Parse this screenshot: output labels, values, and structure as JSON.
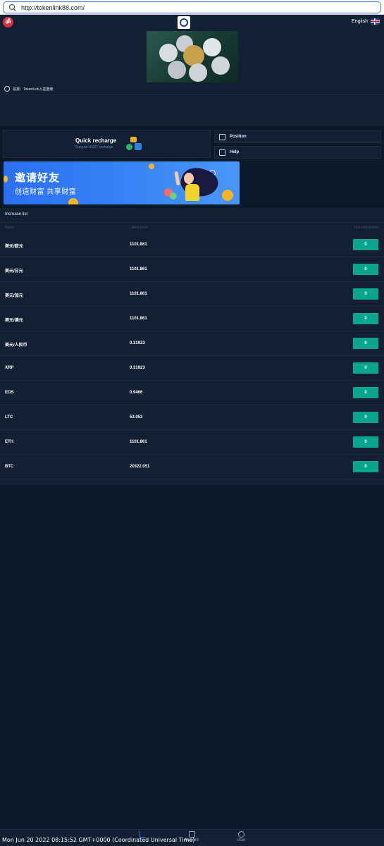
{
  "browser": {
    "url": "http://tokenlink88.com/"
  },
  "header": {
    "language": "English",
    "notice": "喜报：TokenLink入驻重磅"
  },
  "quick_actions": {
    "quick_recharge_title": "Quick recharge",
    "quick_recharge_sub": "Support USDT recharge",
    "position_label": "Position",
    "help_label": "Help"
  },
  "invite_banner": {
    "line1": "邀请好友",
    "line2": "创造财富 共享财富"
  },
  "increase_list": {
    "title": "Increase list",
    "columns": {
      "name": "Name",
      "price": "Latest price",
      "updown": "Ups and downs"
    },
    "rows": [
      {
        "name": "美元/欧元",
        "price": "1101.861",
        "change": "0"
      },
      {
        "name": "美元/日元",
        "price": "1101.861",
        "change": "0"
      },
      {
        "name": "美元/加元",
        "price": "1101.861",
        "change": "0"
      },
      {
        "name": "美元/澳元",
        "price": "1101.861",
        "change": "0"
      },
      {
        "name": "美元/人民币",
        "price": "0.31923",
        "change": "0"
      },
      {
        "name": "XRP",
        "price": "0.31923",
        "change": "0"
      },
      {
        "name": "EOS",
        "price": "0.9466",
        "change": "0"
      },
      {
        "name": "LTC",
        "price": "53.053",
        "change": "0"
      },
      {
        "name": "ETH",
        "price": "1101.861",
        "change": "0"
      },
      {
        "name": "BTC",
        "price": "20322.051",
        "change": "0"
      }
    ]
  },
  "bottom_nav": {
    "record_label": "Record",
    "user_label": "User",
    "active_color": "#2f7ee6"
  },
  "status_clock": "Mon Jun 20 2022 08:15:52 GMT+0000 (Coordinated Universal Time)",
  "colors": {
    "background": "#0b1929",
    "panel": "#132034",
    "change_badge": "#0aa58f",
    "accent": "#2f7ee6"
  }
}
